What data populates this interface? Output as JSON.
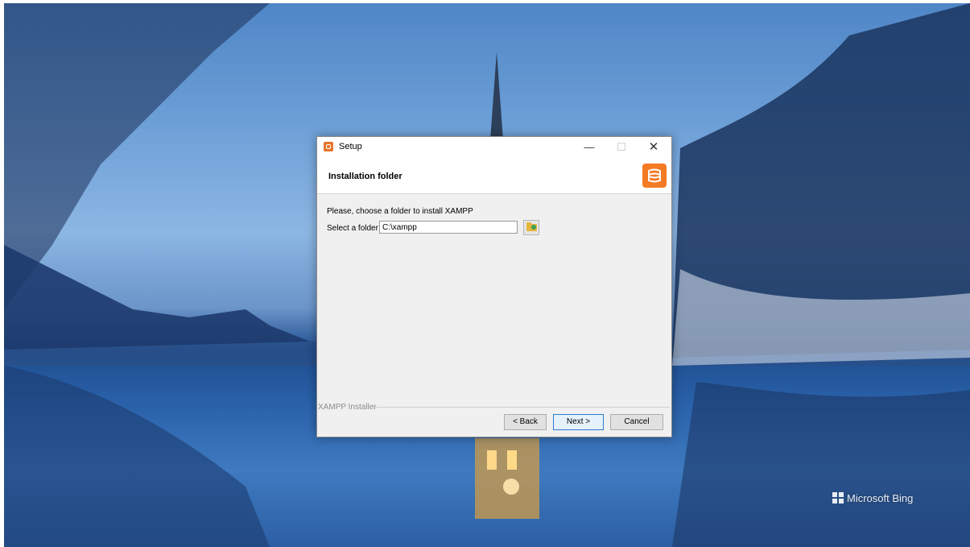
{
  "window": {
    "title": "Setup",
    "minimize_glyph": "—",
    "maximize_glyph": "☐",
    "close_glyph": "✕"
  },
  "header": {
    "title": "Installation folder"
  },
  "content": {
    "prompt": "Please, choose a folder to install XAMPP",
    "folder_label": "Select a folder",
    "folder_value": "C:\\xampp"
  },
  "footer": {
    "group_label": "XAMPP Installer",
    "back_label": "< Back",
    "next_label": "Next >",
    "cancel_label": "Cancel"
  },
  "desktop": {
    "watermark": "Microsoft Bing"
  },
  "colors": {
    "accent": "#f57a24",
    "next_border": "#2e7cd1"
  },
  "icons": [
    "xampp-app-icon",
    "xampp-logo-icon",
    "folder-browse-icon",
    "windows-logo-icon"
  ]
}
